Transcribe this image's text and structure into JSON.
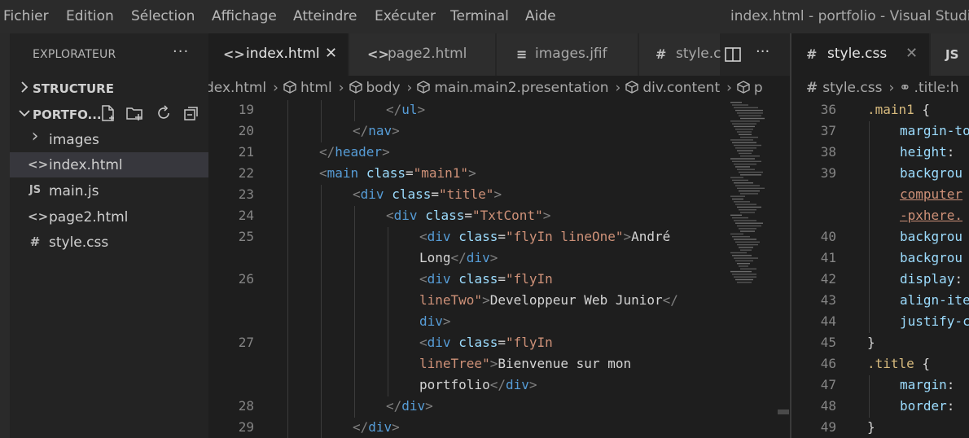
{
  "menu": [
    "Fichier",
    "Edition",
    "Sélection",
    "Affichage",
    "Atteindre",
    "Exécuter",
    "Terminal",
    "Aide"
  ],
  "window_title": "index.html - portfolio - Visual Studio C",
  "sidebar": {
    "header": "EXPLORATEUR",
    "more": "···",
    "structure_label": "STRUCTURE",
    "project_label": "PORTFO...",
    "items": [
      {
        "label": "images",
        "icon": "chevron-right-icon",
        "glyph": "›"
      },
      {
        "label": "index.html",
        "icon": "html-file-icon",
        "glyph": "<>"
      },
      {
        "label": "main.js",
        "icon": "js-file-icon",
        "glyph": "JS"
      },
      {
        "label": "page2.html",
        "icon": "html-file-icon",
        "glyph": "<>"
      },
      {
        "label": "style.css",
        "icon": "css-file-icon",
        "glyph": "#"
      }
    ]
  },
  "tabs_left": [
    {
      "label": "index.html",
      "glyph": "<>",
      "active": true,
      "close": "✕"
    },
    {
      "label": "page2.html",
      "glyph": "<>",
      "active": false
    },
    {
      "label": "images.jfif",
      "glyph": "≡",
      "active": false
    },
    {
      "label": "style.c",
      "glyph": "#",
      "active": false
    }
  ],
  "tabs_right": [
    {
      "label": "style.css",
      "glyph": "#",
      "active": true,
      "close": "✕"
    },
    {
      "label": "JS",
      "glyph": "",
      "active": false
    }
  ],
  "tab_actions": {
    "more": "···"
  },
  "breadcrumb_left": [
    "dex.html",
    "html",
    "body",
    "main.main2.presentation",
    "div.content",
    "p"
  ],
  "breadcrumb_right": [
    "style.css",
    ".title:h"
  ],
  "editor_left": {
    "lines": [
      {
        "n": "19",
        "indent": 3,
        "parts": [
          [
            "t",
            "</"
          ],
          [
            "tn",
            "ul"
          ],
          [
            "t",
            ">"
          ]
        ]
      },
      {
        "n": "20",
        "indent": 2,
        "parts": [
          [
            "t",
            "</"
          ],
          [
            "tn",
            "nav"
          ],
          [
            "t",
            ">"
          ]
        ]
      },
      {
        "n": "21",
        "indent": 1,
        "parts": [
          [
            "t",
            "</"
          ],
          [
            "tn",
            "header"
          ],
          [
            "t",
            ">"
          ]
        ]
      },
      {
        "n": "22",
        "indent": 1,
        "parts": [
          [
            "t",
            "<"
          ],
          [
            "tn",
            "main"
          ],
          [
            "tx",
            " "
          ],
          [
            "an",
            "class"
          ],
          [
            "tx",
            "="
          ],
          [
            "av",
            "\"main1\""
          ],
          [
            "t",
            ">"
          ]
        ]
      },
      {
        "n": "23",
        "indent": 2,
        "parts": [
          [
            "t",
            "<"
          ],
          [
            "tn",
            "div"
          ],
          [
            "tx",
            " "
          ],
          [
            "an",
            "class"
          ],
          [
            "tx",
            "="
          ],
          [
            "av",
            "\"title\""
          ],
          [
            "t",
            ">"
          ]
        ]
      },
      {
        "n": "24",
        "indent": 3,
        "parts": [
          [
            "t",
            "<"
          ],
          [
            "tn",
            "div"
          ],
          [
            "tx",
            " "
          ],
          [
            "an",
            "class"
          ],
          [
            "tx",
            "="
          ],
          [
            "av",
            "\"TxtCont\""
          ],
          [
            "t",
            ">"
          ]
        ]
      },
      {
        "n": "25",
        "indent": 4,
        "parts": [
          [
            "t",
            "<"
          ],
          [
            "tn",
            "div"
          ],
          [
            "tx",
            " "
          ],
          [
            "an",
            "class"
          ],
          [
            "tx",
            "="
          ],
          [
            "av",
            "\"flyIn lineOne\""
          ],
          [
            "t",
            ">"
          ],
          [
            "tx",
            "André"
          ]
        ]
      },
      {
        "n": "",
        "indent": 4,
        "parts": [
          [
            "tx",
            "Long"
          ],
          [
            "t",
            "</"
          ],
          [
            "tn",
            "div"
          ],
          [
            "t",
            ">"
          ]
        ]
      },
      {
        "n": "26",
        "indent": 4,
        "parts": [
          [
            "t",
            "<"
          ],
          [
            "tn",
            "div"
          ],
          [
            "tx",
            " "
          ],
          [
            "an",
            "class"
          ],
          [
            "tx",
            "="
          ],
          [
            "av",
            "\"flyIn"
          ]
        ]
      },
      {
        "n": "",
        "indent": 4,
        "parts": [
          [
            "av",
            "lineTwo\""
          ],
          [
            "t",
            ">"
          ],
          [
            "tx",
            "Developpeur Web Junior"
          ],
          [
            "t",
            "</"
          ]
        ]
      },
      {
        "n": "",
        "indent": 4,
        "parts": [
          [
            "tn",
            "div"
          ],
          [
            "t",
            ">"
          ]
        ]
      },
      {
        "n": "27",
        "indent": 4,
        "parts": [
          [
            "t",
            "<"
          ],
          [
            "tn",
            "div"
          ],
          [
            "tx",
            " "
          ],
          [
            "an",
            "class"
          ],
          [
            "tx",
            "="
          ],
          [
            "av",
            "\"flyIn"
          ]
        ]
      },
      {
        "n": "",
        "indent": 4,
        "parts": [
          [
            "av",
            "lineTree\""
          ],
          [
            "t",
            ">"
          ],
          [
            "tx",
            "Bienvenue sur mon"
          ]
        ]
      },
      {
        "n": "",
        "indent": 4,
        "parts": [
          [
            "tx",
            "portfolio"
          ],
          [
            "t",
            "</"
          ],
          [
            "tn",
            "div"
          ],
          [
            "t",
            ">"
          ]
        ]
      },
      {
        "n": "28",
        "indent": 3,
        "parts": [
          [
            "t",
            "</"
          ],
          [
            "tn",
            "div"
          ],
          [
            "t",
            ">"
          ]
        ]
      },
      {
        "n": "29",
        "indent": 2,
        "parts": [
          [
            "t",
            "</"
          ],
          [
            "tn",
            "div"
          ],
          [
            "t",
            ">"
          ]
        ]
      }
    ]
  },
  "editor_right": {
    "lines": [
      {
        "n": "36",
        "indent": 0,
        "parts": [
          [
            "sel",
            ".main1"
          ],
          [
            "tx",
            " {"
          ]
        ]
      },
      {
        "n": "37",
        "indent": 1,
        "parts": [
          [
            "prop",
            "margin-to"
          ]
        ]
      },
      {
        "n": "38",
        "indent": 1,
        "parts": [
          [
            "prop",
            "height"
          ],
          [
            "tx",
            ": "
          ]
        ]
      },
      {
        "n": "39",
        "indent": 1,
        "parts": [
          [
            "prop",
            "backgrou"
          ]
        ]
      },
      {
        "n": "",
        "indent": 1,
        "parts": [
          [
            "pv",
            "computer"
          ]
        ]
      },
      {
        "n": "",
        "indent": 1,
        "parts": [
          [
            "pv",
            "-pxhere."
          ]
        ]
      },
      {
        "n": "40",
        "indent": 1,
        "parts": [
          [
            "prop",
            "backgrou"
          ]
        ]
      },
      {
        "n": "41",
        "indent": 1,
        "parts": [
          [
            "prop",
            "backgrou"
          ]
        ]
      },
      {
        "n": "42",
        "indent": 1,
        "parts": [
          [
            "prop",
            "display"
          ],
          [
            "tx",
            ":"
          ]
        ]
      },
      {
        "n": "43",
        "indent": 1,
        "parts": [
          [
            "prop",
            "align-ite"
          ]
        ]
      },
      {
        "n": "44",
        "indent": 1,
        "parts": [
          [
            "prop",
            "justify-c"
          ]
        ]
      },
      {
        "n": "45",
        "indent": 0,
        "parts": [
          [
            "tx",
            "}"
          ]
        ]
      },
      {
        "n": "46",
        "indent": 0,
        "parts": [
          [
            "sel",
            ".title"
          ],
          [
            "tx",
            " {"
          ]
        ]
      },
      {
        "n": "47",
        "indent": 1,
        "parts": [
          [
            "prop",
            "margin"
          ],
          [
            "tx",
            ": "
          ]
        ]
      },
      {
        "n": "48",
        "indent": 1,
        "parts": [
          [
            "prop",
            "border"
          ],
          [
            "tx",
            ": "
          ]
        ]
      },
      {
        "n": "49",
        "indent": 0,
        "parts": [
          [
            "tx",
            "}"
          ]
        ]
      }
    ]
  }
}
